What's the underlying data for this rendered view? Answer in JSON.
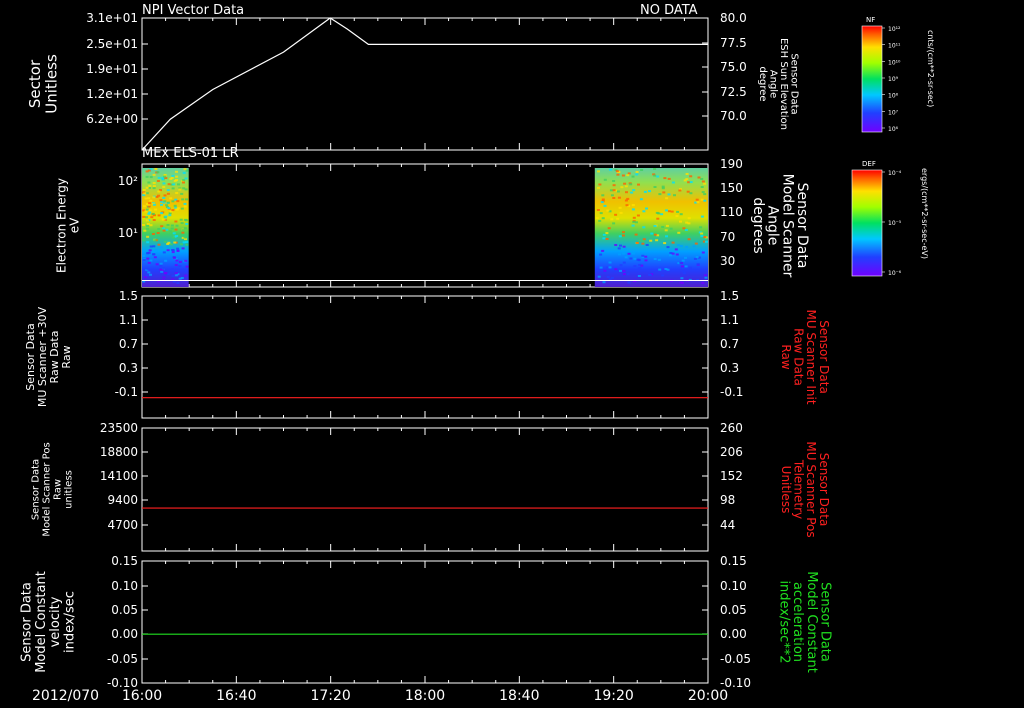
{
  "colors": {
    "white": "#ffffff",
    "red": "#ff2020",
    "green": "#20e020",
    "background": "#000000"
  },
  "chart_data": [
    {
      "type": "line",
      "title": "NPI Vector Data",
      "status": "NO DATA",
      "ylabel": [
        "Sector",
        "Unitless"
      ],
      "yticks": [
        "3.1e+01",
        "2.5e+01",
        "1.9e+01",
        "1.2e+01",
        "6.2e+00"
      ],
      "y2label": [
        "Sensor Data",
        "ESH Sun Elevation",
        "Angle",
        "degree"
      ],
      "y2ticks": [
        "80.0",
        "77.5",
        "75.0",
        "72.5",
        "70.0"
      ],
      "y2lim": [
        68,
        80
      ],
      "series": [
        {
          "color": "#ffffff",
          "x": [
            0,
            0.2,
            0.5,
            1,
            1.33,
            1.45,
            1.6,
            1.75,
            4
          ],
          "y": [
            68.0,
            70.8,
            73.5,
            76.9,
            80.0,
            79.0,
            77.6,
            77.6,
            77.6
          ]
        }
      ]
    },
    {
      "type": "heatmap",
      "title": "MEx ELS-01 LR",
      "ylabel": [
        "Electron Energy",
        "eV"
      ],
      "yticks": [
        "10²",
        "10¹"
      ],
      "y2label": [
        "Sensor Data",
        "Model Scanner",
        "Angle",
        "degrees"
      ],
      "y2ticks": [
        "190",
        "150",
        "110",
        "70",
        "30"
      ],
      "y2lim": [
        0,
        190
      ],
      "data_blocks": [
        {
          "x_start": 0,
          "x_end": 0.33
        },
        {
          "x_start": 3.2,
          "x_end": 4
        }
      ],
      "series": [
        {
          "color": "#ffffff",
          "y_value": 10
        }
      ]
    },
    {
      "type": "line",
      "ylabel": [
        "Sensor Data",
        "MU Scanner +30V",
        "Raw Data",
        "Raw"
      ],
      "yticks": [
        "1.5",
        "1.1",
        "0.7",
        "0.3",
        "-0.1"
      ],
      "y2label": [
        "Sensor Data",
        "MU Scanner Init",
        "Raw Data",
        "Raw"
      ],
      "y2ticks": [
        "1.5",
        "1.1",
        "0.7",
        "0.3",
        "-0.1"
      ],
      "ylim": [
        -0.3,
        1.5
      ],
      "series": [
        {
          "color": "#ff2020",
          "value": 0.0
        }
      ]
    },
    {
      "type": "line",
      "ylabel": [
        "Sensor Data",
        "Model Scanner Pos",
        "Raw",
        "unitless"
      ],
      "yticks": [
        "23500",
        "18800",
        "14100",
        "9400",
        "4700"
      ],
      "y2label": [
        "Sensor Data",
        "MU Scanner Pos",
        "Telemetry",
        "Unitless"
      ],
      "y2ticks": [
        "260",
        "206",
        "152",
        "98",
        "44"
      ],
      "ylim": [
        0,
        23500
      ],
      "series": [
        {
          "color": "#ff2020",
          "value": 8200
        }
      ]
    },
    {
      "type": "line",
      "ylabel": [
        "Sensor Data",
        "Model Constant",
        "velocity",
        "index/sec"
      ],
      "yticks": [
        "0.15",
        "0.10",
        "0.05",
        "0.00",
        "-0.05",
        "-0.10"
      ],
      "y2label": [
        "Sensor Data",
        "Model Constant",
        "acceleration",
        "index/sec**2"
      ],
      "y2ticks": [
        "0.15",
        "0.10",
        "0.05",
        "0.00",
        "-0.05",
        "-0.10"
      ],
      "ylim": [
        -0.1,
        0.15
      ],
      "series": [
        {
          "color": "#20e020",
          "value": 0.0
        }
      ]
    }
  ],
  "xaxis": {
    "date": "2012/070",
    "ticks": [
      "16:00",
      "16:40",
      "17:20",
      "18:00",
      "18:40",
      "19:20",
      "20:00"
    ]
  },
  "colorbars": [
    {
      "label": "NF",
      "units": "cnts/(cm**2-sr-sec)",
      "ticks": [
        "10¹²",
        "10¹¹",
        "10¹⁰",
        "10⁹",
        "10⁸",
        "10⁷",
        "10⁶"
      ]
    },
    {
      "label": "DEF",
      "units": "ergs/(cm**2-sr-sec-eV)",
      "ticks": [
        "10⁻⁴",
        "10⁻⁵",
        "10⁻⁶"
      ]
    }
  ]
}
